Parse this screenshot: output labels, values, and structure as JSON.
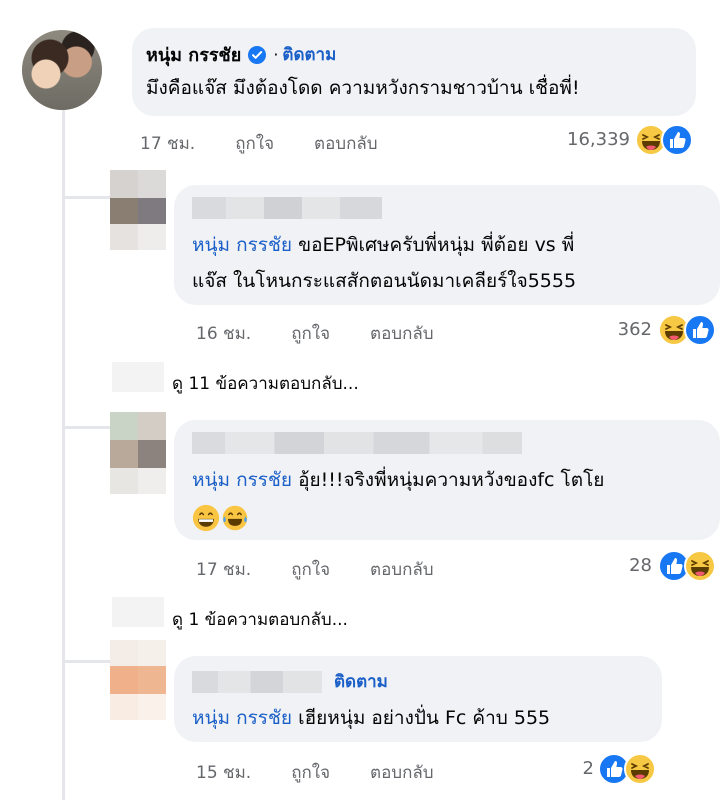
{
  "main_comment": {
    "author": "หนุ่ม กรรชัย",
    "separator": "·",
    "follow": "ติดตาม",
    "text": "มึงคือแจ๊ส มึงต้องโดด  ความหวังกรามชาวบ้าน เชื่อพี่!",
    "time": "17 ชม.",
    "like": "ถูกใจ",
    "reply": "ตอบกลับ",
    "reaction_count": "16,339",
    "reactions": [
      "haha-icon",
      "like-icon"
    ]
  },
  "replies": [
    {
      "mention": "หนุ่ม กรรชัย",
      "text_line1": "ขอEPพิเศษครับพี่หนุ่ม พี่ต้อย vs พี่",
      "text_line2": "แจ๊ส ในโหนกระแสสักตอนนัดมาเคลียร์ใจ5555",
      "time": "16 ชม.",
      "like": "ถูกใจ",
      "reply": "ตอบกลับ",
      "reaction_count": "362",
      "reactions": [
        "haha-icon",
        "like-icon"
      ],
      "view_more": "ดู 11 ข้อความตอบกลับ..."
    },
    {
      "mention": "หนุ่ม กรรชัย",
      "text_line1": "อุ้ย!!!จริงพี่หนุ่มความหวังของfc โตโย",
      "text_line2": "",
      "time": "17 ชม.",
      "like": "ถูกใจ",
      "reply": "ตอบกลับ",
      "reaction_count": "28",
      "reactions": [
        "like-icon",
        "haha-icon"
      ],
      "inline_emojis": [
        "grin-emoji",
        "tears-of-joy-emoji"
      ],
      "view_more": "ดู 1 ข้อความตอบกลับ..."
    },
    {
      "follow": "ติดตาม",
      "mention": "หนุ่ม กรรชัย",
      "text_line1": "เฮียหนุ่ม อย่างปั่น Fc ค้าบ 555",
      "time": "15 ชม.",
      "like": "ถูกใจ",
      "reply": "ตอบกลับ",
      "reaction_count": "2",
      "reactions": [
        "like-icon",
        "haha-icon"
      ]
    }
  ],
  "colors": {
    "bubble": "#f0f2f5",
    "link": "#1b5fc8",
    "verified": "#1877f2",
    "meta": "#65676b",
    "thread": "#e4e6eb"
  }
}
